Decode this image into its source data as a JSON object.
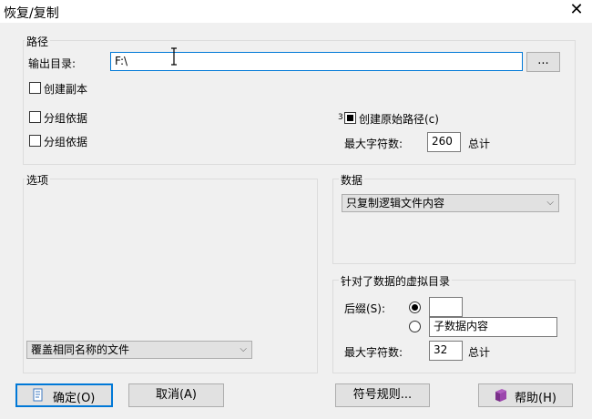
{
  "window": {
    "title": "恢复/复制",
    "close_glyph": "✕"
  },
  "path_group": {
    "legend": "路径",
    "output_label": "输出目录:",
    "output_value": "F:\\",
    "browse_label": "...",
    "create_copy_label": "创建副本",
    "group_by_1_label": "分组依据",
    "group_by_2_label": "分组依据",
    "create_original_path_prefix": "3",
    "create_original_path_label": "创建原始路径(c)",
    "max_chars_label": "最大字符数:",
    "max_chars_value": "260",
    "max_chars_unit": "总计"
  },
  "options_group": {
    "legend": "选项",
    "overwrite_select_value": "覆盖相同名称的文件"
  },
  "data_group": {
    "legend": "数据",
    "copy_select_value": "只复制逻辑文件内容"
  },
  "virtual_dir_group": {
    "legend": "针对了数据的虚拟目录",
    "suffix_label": "后缀(S):",
    "suffix_value": "",
    "subdata_value": "子数据内容",
    "max_chars_label": "最大字符数:",
    "max_chars_value": "32",
    "max_chars_unit": "总计"
  },
  "buttons": {
    "ok": "确定(O)",
    "cancel": "取消(A)",
    "symbol_rules": "符号规则...",
    "help": "帮助(H)"
  }
}
